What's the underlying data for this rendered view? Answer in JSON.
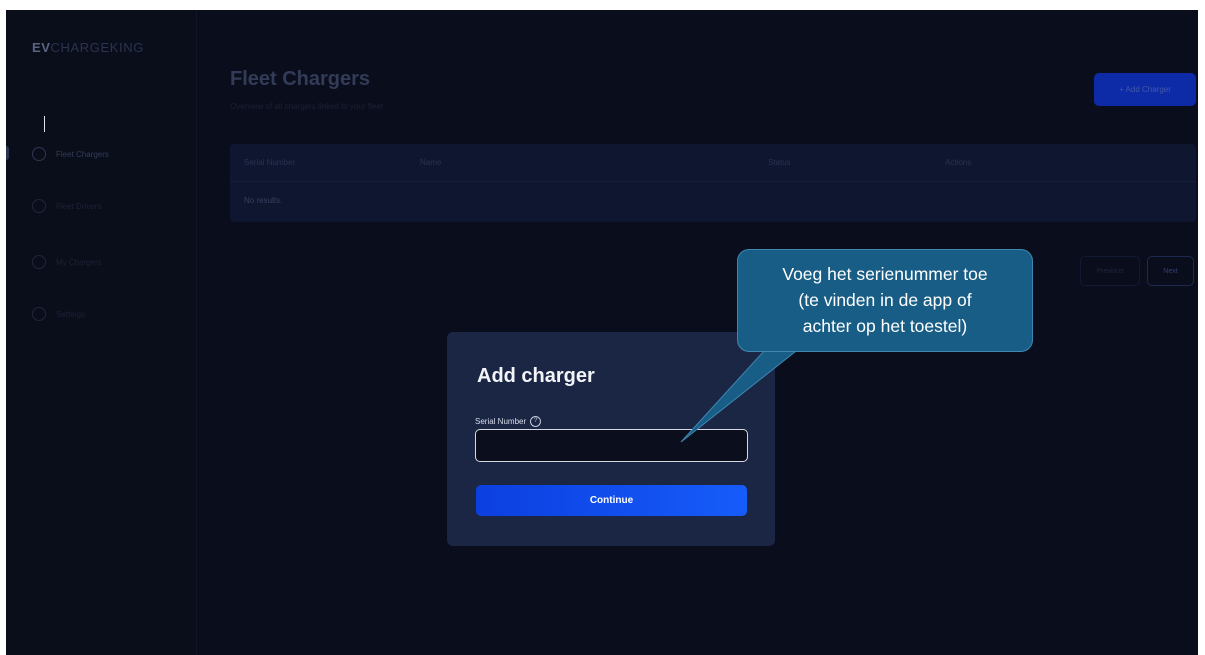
{
  "app": {
    "logo_prefix": "EV",
    "logo_name": "CHARGEKING"
  },
  "sidebar": {
    "items": [
      {
        "label": "Fleet Chargers",
        "icon": "charger-icon",
        "active": true
      },
      {
        "label": "Fleet Drivers",
        "icon": "user-icon",
        "active": false
      },
      {
        "label": "My Chargers",
        "icon": "plug-icon",
        "active": false
      },
      {
        "label": "Settings",
        "icon": "gear-icon",
        "active": false
      }
    ]
  },
  "main": {
    "title": "Fleet Chargers",
    "subtitle": "Overview of all chargers linked to your fleet",
    "add_charger_label": "+ Add Charger",
    "table": {
      "columns": [
        "Serial Number",
        "Name",
        "Status",
        "Actions"
      ],
      "empty_text": "No results."
    },
    "pagination": {
      "previous_label": "Previous",
      "next_label": "Next"
    }
  },
  "modal": {
    "title": "Add charger",
    "field_label": "Serial Number",
    "help_icon": "question-circle-icon",
    "input_value": "",
    "continue_label": "Continue"
  },
  "callout": {
    "lines": [
      "Voeg het serienummer toe",
      "(te vinden in de app of",
      "achter op het toestel)"
    ]
  },
  "colors": {
    "background": "#0a0e1c",
    "modal": "#1b2645",
    "accent": "#165cfa",
    "callout": "#185d86"
  }
}
